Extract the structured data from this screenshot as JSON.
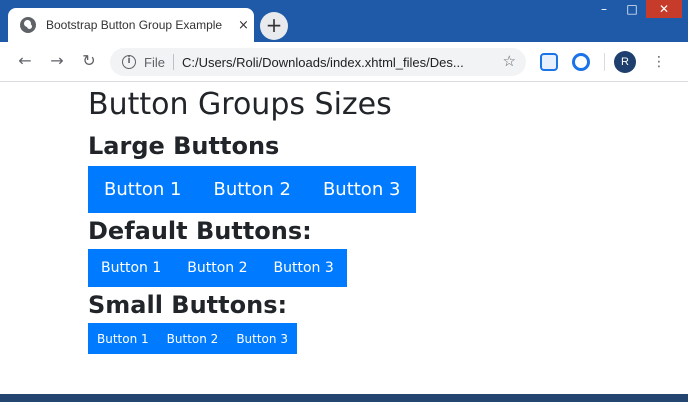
{
  "browser": {
    "tab_title": "Bootstrap Button Group Example",
    "tab_close": "×",
    "new_tab": "+",
    "back": "←",
    "forward": "→",
    "reload": "↻",
    "info_icon_glyph": "i",
    "file_label": "File",
    "url": "C:/Users/Roli/Downloads/index.xhtml_files/Des...",
    "star": "☆",
    "avatar_initial": "R",
    "menu": "⋮",
    "minimize": "–",
    "maximize": "□",
    "close": "✕"
  },
  "page": {
    "title": "Button Groups Sizes",
    "sections": [
      {
        "heading": "Large Buttons",
        "buttons": [
          "Button 1",
          "Button 2",
          "Button 3"
        ]
      },
      {
        "heading": "Default Buttons:",
        "buttons": [
          "Button 1",
          "Button 2",
          "Button 3"
        ]
      },
      {
        "heading": "Small Buttons:",
        "buttons": [
          "Button 1",
          "Button 2",
          "Button 3"
        ]
      }
    ]
  },
  "colors": {
    "primary": "#007bff",
    "titlebar": "#1e5aa8",
    "text": "#212529"
  }
}
